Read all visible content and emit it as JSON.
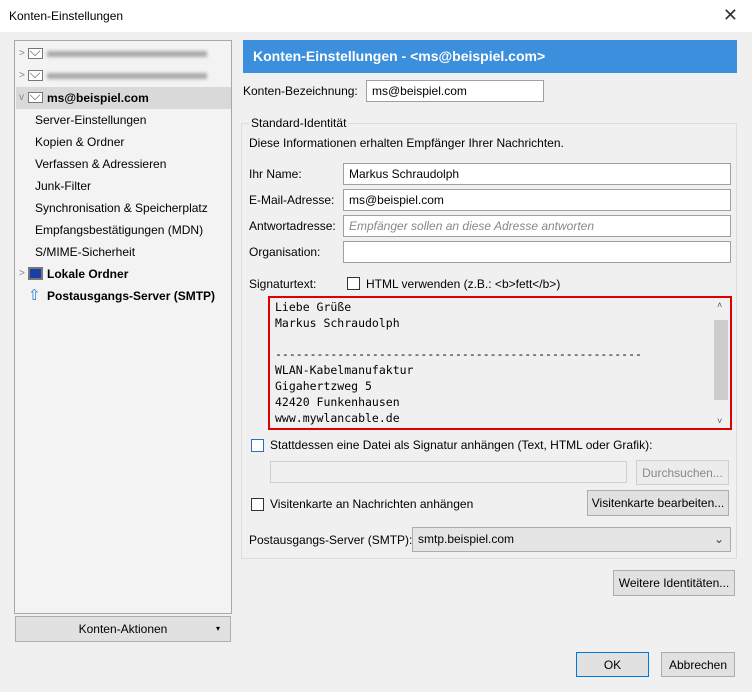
{
  "window": {
    "title": "Konten-Einstellungen"
  },
  "tree": {
    "accounts_blurred": 2,
    "account": "ms@beispiel.com",
    "subitems": [
      "Server-Einstellungen",
      "Kopien & Ordner",
      "Verfassen & Adressieren",
      "Junk-Filter",
      "Synchronisation & Speicherplatz",
      "Empfangsbestätigungen (MDN)",
      "S/MIME-Sicherheit"
    ],
    "local": "Lokale Ordner",
    "smtp": "Postausgangs-Server (SMTP)"
  },
  "account_actions": "Konten-Aktionen",
  "panel": {
    "title": "Konten-Einstellungen - <ms@beispiel.com>",
    "name_label": "Konten-Bezeichnung:",
    "name_value": "ms@beispiel.com",
    "group_title": "Standard-Identität",
    "group_desc": "Diese Informationen erhalten Empfänger Ihrer Nachrichten.",
    "fields": [
      {
        "label": "Ihr Name:",
        "value": "Markus Schraudolph",
        "placeholder": ""
      },
      {
        "label": "E-Mail-Adresse:",
        "value": "ms@beispiel.com",
        "placeholder": ""
      },
      {
        "label": "Antwortadresse:",
        "value": "",
        "placeholder": "Empfänger sollen an diese Adresse antworten"
      },
      {
        "label": "Organisation:",
        "value": "",
        "placeholder": ""
      }
    ],
    "sig_label": "Signaturtext:",
    "html_label": "HTML verwenden (z.B.: <b>fett</b>)",
    "signature": "Liebe Grüße\nMarkus Schraudolph\n\n-----------------------------------------------------\nWLAN-Kabelmanufaktur\nGigahertzweg 5\n42420 Funkenhausen\nwww.mywlancable.de",
    "file_label": "Stattdessen eine Datei als Signatur anhängen (Text, HTML oder Grafik):",
    "browse": "Durchsuchen...",
    "vcard_label": "Visitenkarte an Nachrichten anhängen",
    "vcard_edit": "Visitenkarte bearbeiten...",
    "smtp_label": "Postausgangs-Server (SMTP):",
    "smtp_value": "smtp.beispiel.com",
    "more_ids": "Weitere Identitäten..."
  },
  "ok": "OK",
  "cancel": "Abbrechen"
}
